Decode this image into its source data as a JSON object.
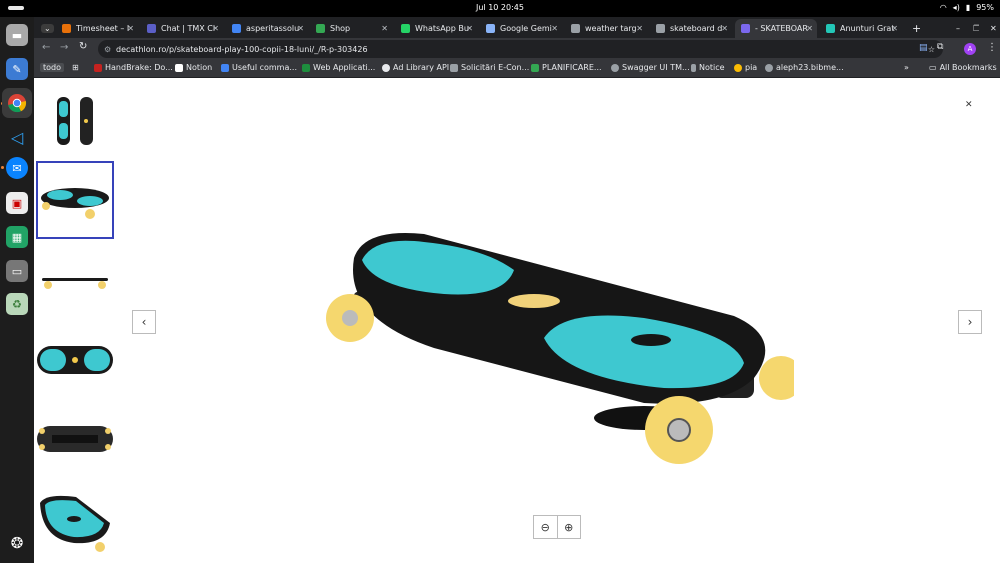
{
  "system_bar": {
    "clock": "Jul 10  20:45",
    "battery": "95%"
  },
  "tabs": [
    {
      "title": "Timesheet – I",
      "color": "#e8710a"
    },
    {
      "title": "Chat | TMX Cl",
      "color": "#5b5fc7"
    },
    {
      "title": "asperitassolu",
      "color": "#4285f4"
    },
    {
      "title": "Shop",
      "color": "#34a853"
    },
    {
      "title": "WhatsApp Bu",
      "color": "#25d366"
    },
    {
      "title": "Google Gemi",
      "color": "#8ab4f8"
    },
    {
      "title": "weather targ",
      "color": "#9aa0a6"
    },
    {
      "title": "skateboard d",
      "color": "#9aa0a6"
    },
    {
      "title": "- SKATEBOAR",
      "color": "#7b68ee"
    },
    {
      "title": "Anunturi Grat",
      "color": "#23c7b7"
    }
  ],
  "address": "decathlon.ro/p/skateboard-play-100-copii-18-luni/_/R-p-303426",
  "profile": "A",
  "bookmarks": [
    {
      "label": "todo"
    },
    {
      "label": "HandBrake: Do...",
      "color": "#c5221f"
    },
    {
      "label": "Notion",
      "color": "#ffffff"
    },
    {
      "label": "Useful comma...",
      "color": "#4285f4"
    },
    {
      "label": "Web Applicati...",
      "color": "#1e8e3e"
    },
    {
      "label": "Ad Library API",
      "color": "#e8eaed"
    },
    {
      "label": "Solicitări E-Con...",
      "color": "#9aa0a6"
    },
    {
      "label": "PLANIFICARE...",
      "color": "#34a853"
    },
    {
      "label": "Swagger UI TM...",
      "color": "#9aa0a6"
    },
    {
      "label": "Notice",
      "color": "#9aa0a6"
    },
    {
      "label": "pia",
      "color": "#fbbc04"
    },
    {
      "label": "aleph23.bibme...",
      "color": "#9aa0a6"
    },
    {
      "label": "All Bookmarks"
    }
  ],
  "dock": [
    "files",
    "text-editor",
    "chrome",
    "vscode",
    "thunderbird",
    "screenshot",
    "spreadsheet",
    "removable-drive",
    "trash"
  ],
  "gallery": {
    "thumbnails": [
      "front-view",
      "angled-view",
      "side-view",
      "top-view",
      "bottom-view",
      "deck-closeup"
    ],
    "selected_index": 1
  }
}
